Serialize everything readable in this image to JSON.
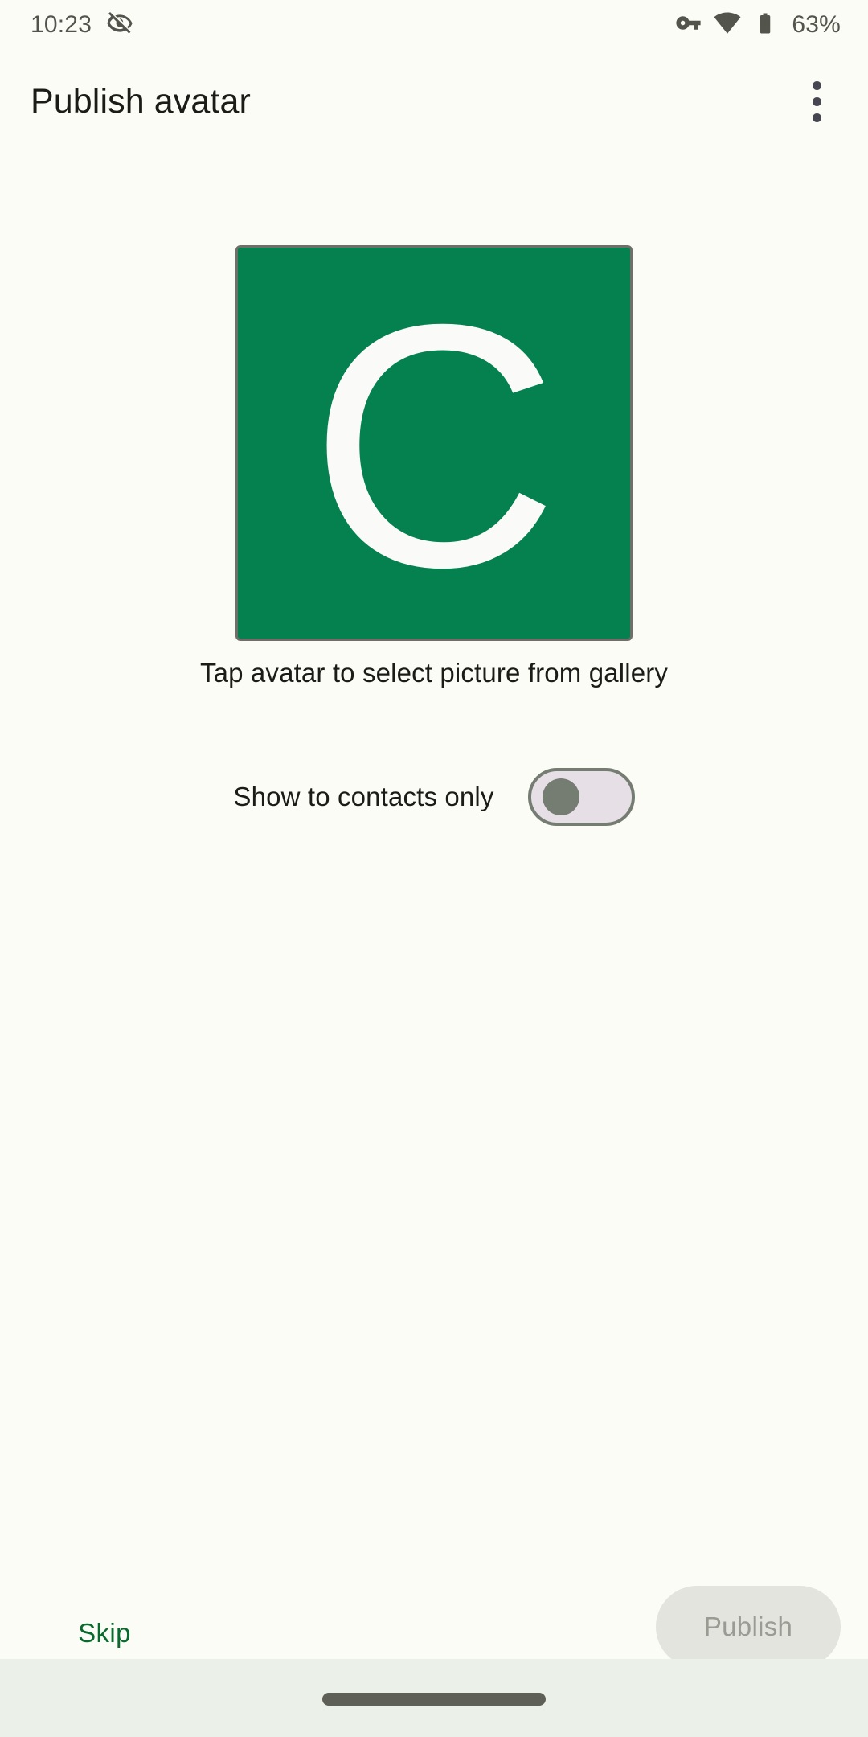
{
  "status_bar": {
    "time": "10:23",
    "battery_percent": "63%",
    "icons": {
      "notification": "eye-off-icon",
      "vpn": "vpn-key-icon",
      "wifi": "wifi-icon",
      "battery": "battery-icon"
    }
  },
  "app_bar": {
    "title": "Publish avatar",
    "overflow_menu": "more-options-icon"
  },
  "avatar": {
    "initial": "C",
    "background_color": "#05804F",
    "caption": "Tap avatar to select picture from gallery"
  },
  "settings": {
    "contacts_only": {
      "label": "Show to contacts only",
      "checked": false
    }
  },
  "actions": {
    "skip_label": "Skip",
    "publish_label": "Publish",
    "publish_enabled": false
  },
  "colors": {
    "page_background": "#FBFCF5",
    "accent_green": "#0A6A2E",
    "avatar_green": "#05804F",
    "disabled_button_bg": "#E2E4DD",
    "disabled_button_text": "#9A9C94",
    "switch_track": "#E6E0E6",
    "switch_outline": "#757C71",
    "nav_bar_background": "#EBF0E8"
  }
}
